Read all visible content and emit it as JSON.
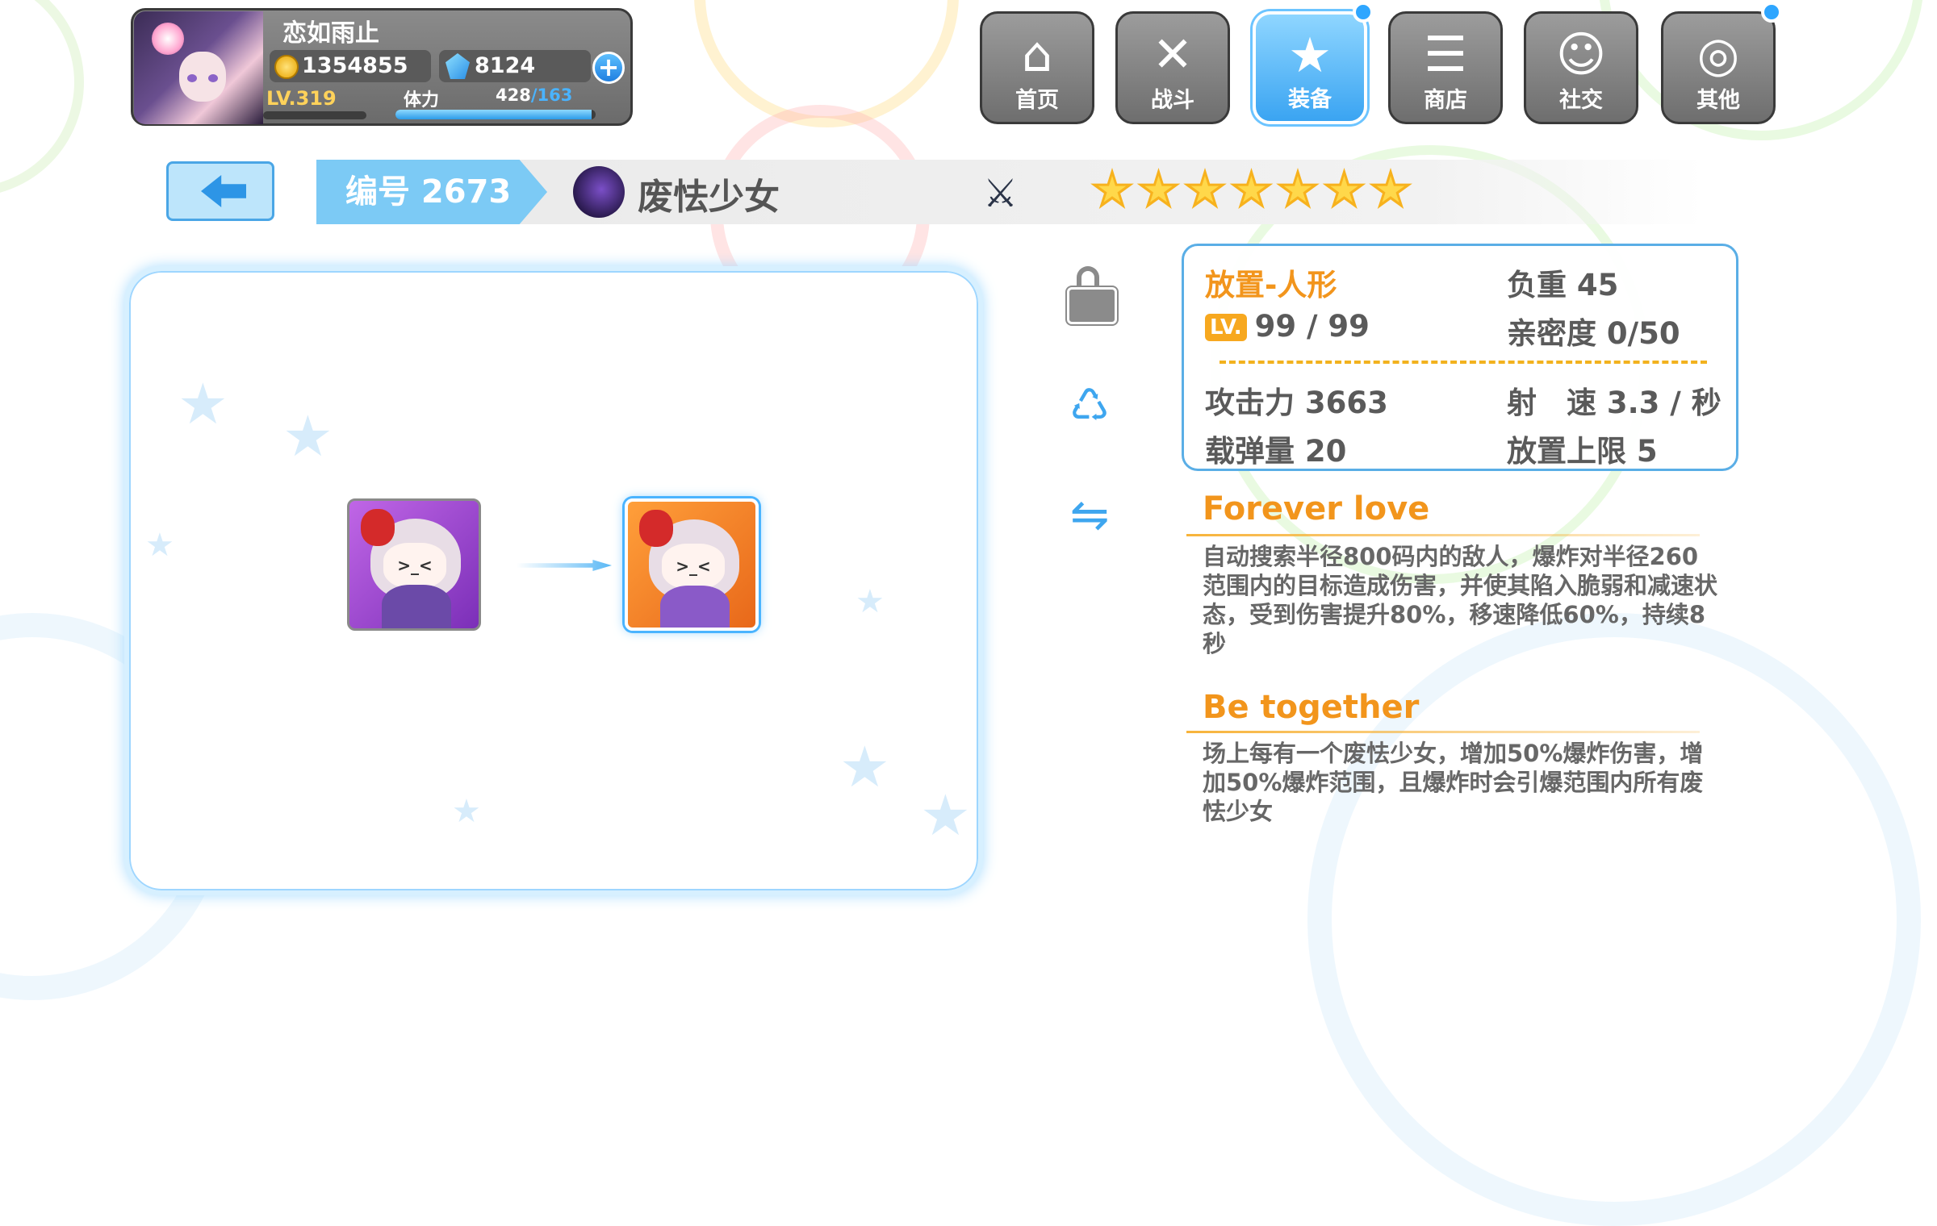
{
  "player": {
    "name": "恋如雨止",
    "gold": "1354855",
    "gems": "8124",
    "level": "LV.319",
    "stamina_label": "体力",
    "stamina_current": "428",
    "stamina_max": "/163",
    "stamina_fill": 0.98
  },
  "nav": {
    "items": [
      {
        "label": "首页",
        "icon": "house-icon"
      },
      {
        "label": "战斗",
        "icon": "crossed-guns-icon"
      },
      {
        "label": "装备",
        "icon": "star-gun-icon",
        "active": true
      },
      {
        "label": "商店",
        "icon": "shopping-basket-icon"
      },
      {
        "label": "社交",
        "icon": "person-icon"
      },
      {
        "label": "其他",
        "icon": "snail-icon"
      }
    ]
  },
  "header": {
    "id_text": "编号 2673",
    "name": "废怯少女",
    "star_count": 7
  },
  "stats": {
    "type": "放置-人形",
    "weight": "负重 45",
    "lv_badge": "LV.",
    "level": "99 / 99",
    "intimacy": "亲密度 0/50",
    "attack": "攻击力 3663",
    "fire_rate": "射　速 3.3 / 秒",
    "ammo": "载弹量 20",
    "place_limit": "放置上限 5"
  },
  "skills": [
    {
      "title": "Forever love",
      "desc": "自动搜索半径800码内的敌人，爆炸对半径260范围内的目标造成伤害，并使其陷入脆弱和减速状态，受到伤害提升80%，移速降低60%，持续8秒"
    },
    {
      "title": "Be together",
      "desc": "场上每有一个废怯少女，增加50%爆炸伤害，增加50%爆炸范围，且爆炸时会引爆范围内所有废怯少女"
    }
  ],
  "colors": {
    "accent_blue": "#4ab4ff",
    "skill_orange": "#f2951c",
    "star_gold": "#f7b21e"
  }
}
